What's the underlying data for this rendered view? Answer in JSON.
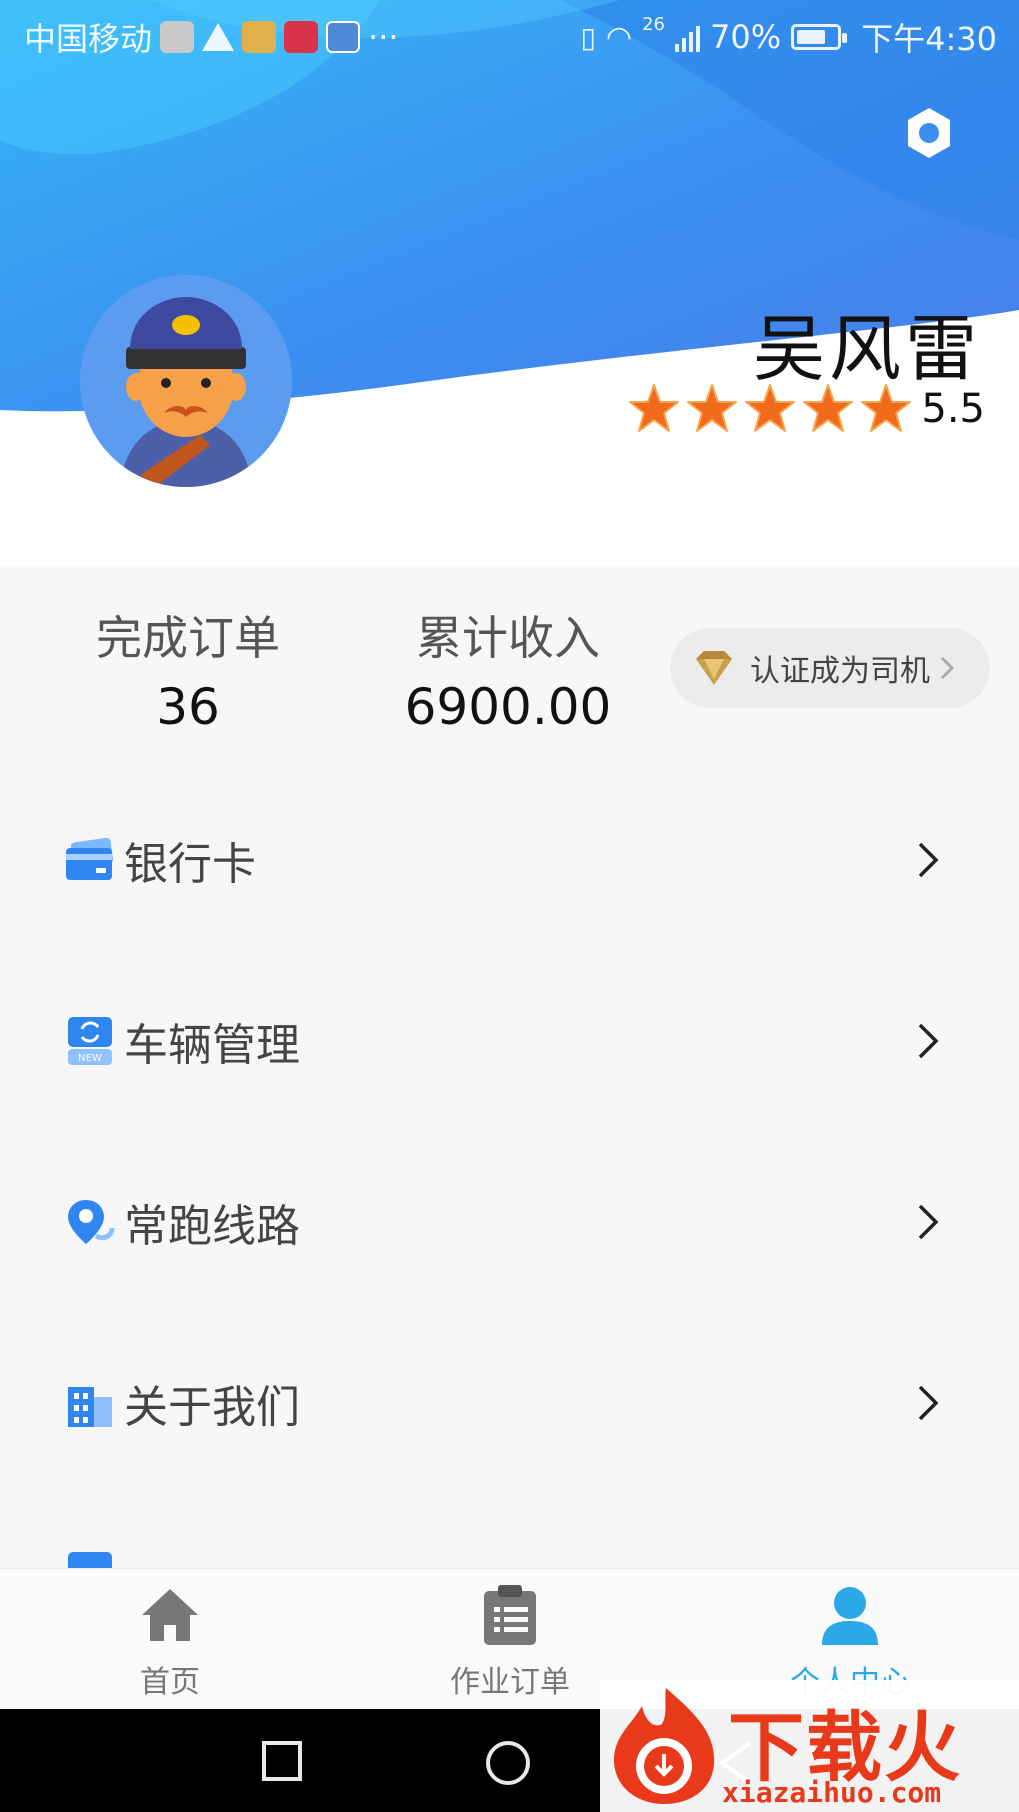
{
  "statusbar": {
    "carrier": "中国移动",
    "network": "26",
    "battery": "70%",
    "time": "下午4:30"
  },
  "profile": {
    "name": "吴风雷",
    "rating": "5.5",
    "stars": 5
  },
  "stats": {
    "orders_label": "完成订单",
    "orders_value": "36",
    "income_label": "累计收入",
    "income_value": "6900.00",
    "certify_label": "认证成为司机"
  },
  "menu": {
    "items": [
      {
        "label": "银行卡",
        "icon": "bank-card-icon"
      },
      {
        "label": "车辆管理",
        "icon": "vehicle-new-icon"
      },
      {
        "label": "常跑线路",
        "icon": "route-location-icon"
      },
      {
        "label": "关于我们",
        "icon": "building-icon"
      }
    ]
  },
  "tabs": [
    {
      "label": "首页",
      "icon": "home-icon",
      "active": false
    },
    {
      "label": "作业订单",
      "icon": "clipboard-icon",
      "active": false
    },
    {
      "label": "个人中心",
      "icon": "user-icon",
      "active": true
    }
  ],
  "watermark": {
    "title": "下载火",
    "url": "xiazaihuo.com"
  },
  "colors": {
    "header_blue": "#3b8ff0",
    "accent": "#2aa8e8",
    "star": "#f26a1b"
  }
}
